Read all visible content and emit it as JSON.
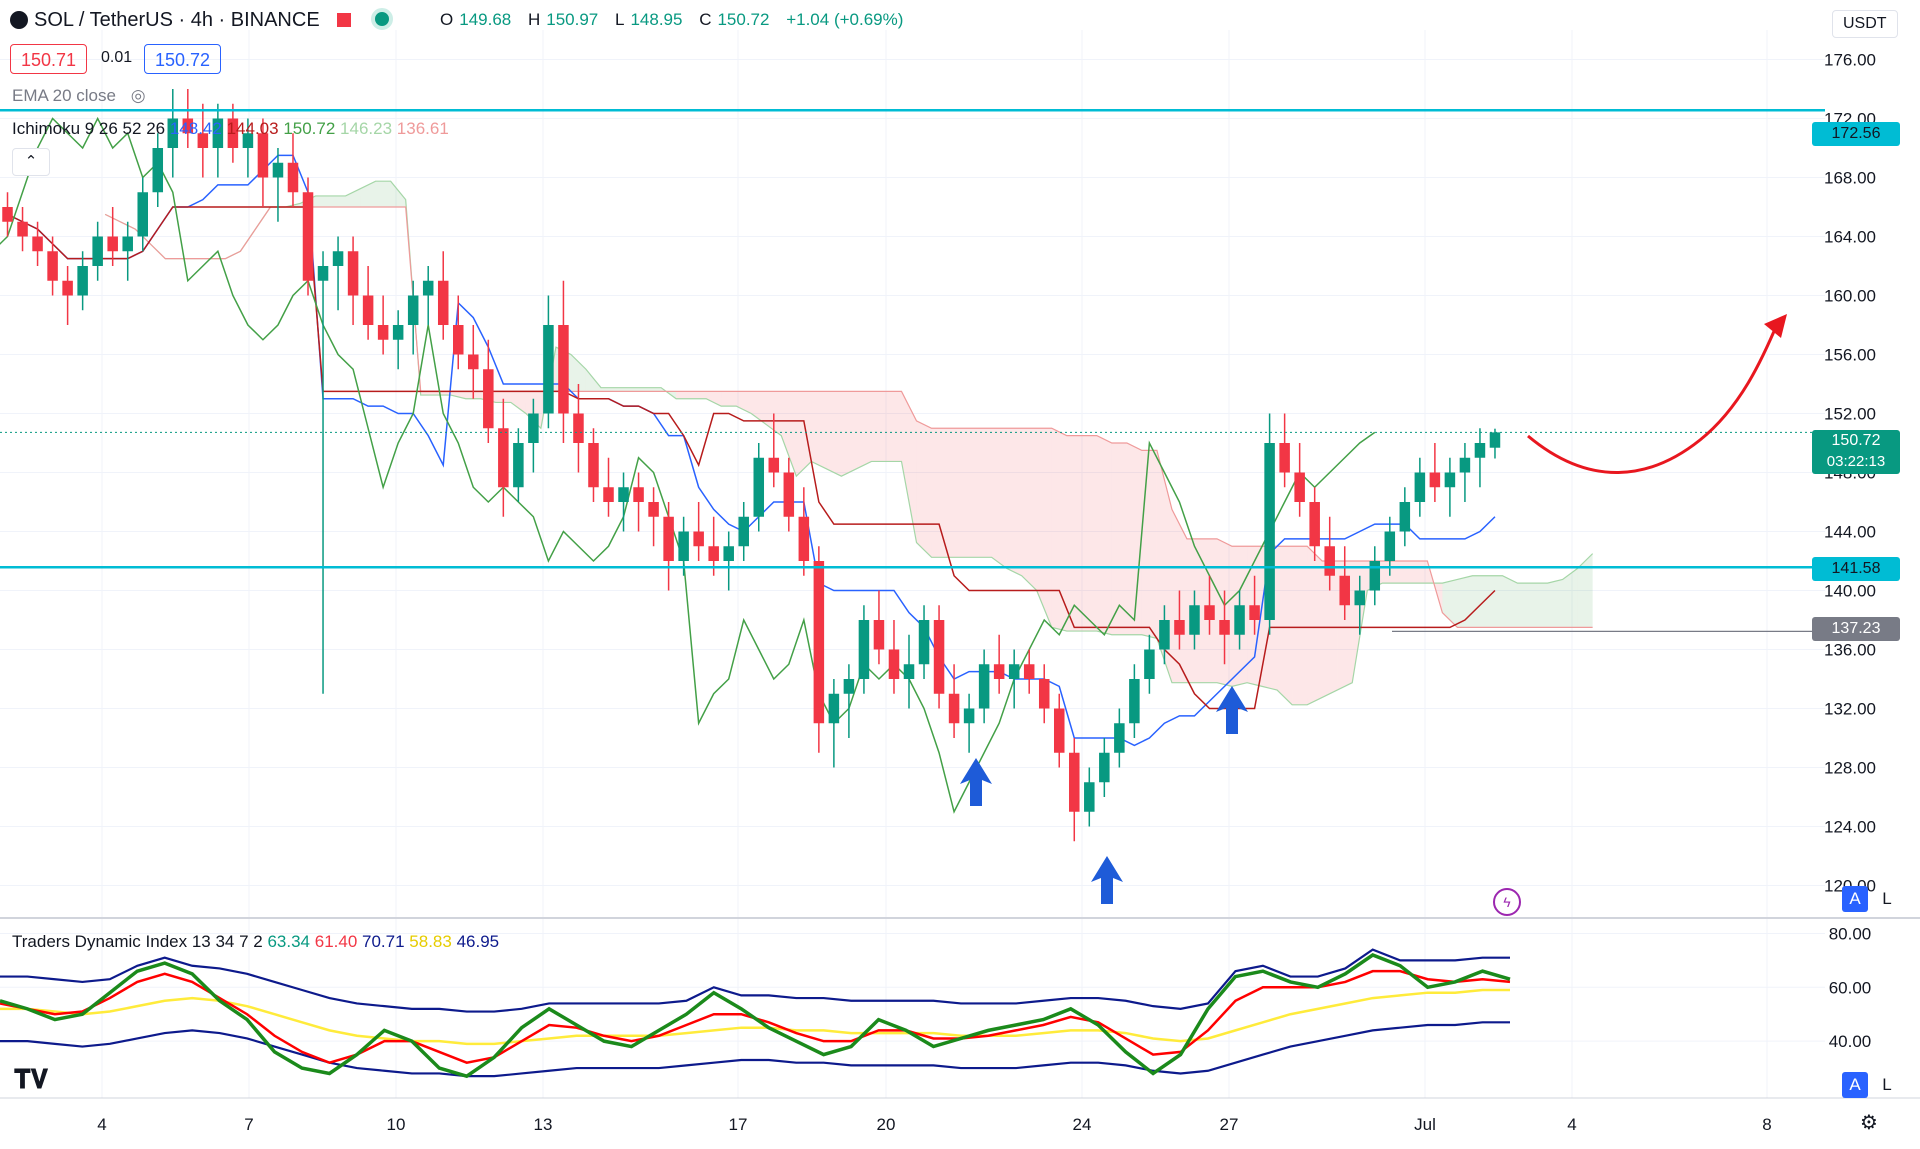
{
  "header": {
    "symbol": "SOL / TetherUS · 4h · BINANCE",
    "open_label": "O",
    "open": "149.68",
    "high_label": "H",
    "high": "150.97",
    "low_label": "L",
    "low": "148.95",
    "close_label": "C",
    "close": "150.72",
    "change": "+1.04 (+0.69%)",
    "sell_price": "150.71",
    "spread": "0.01",
    "buy_price": "150.72",
    "currency": "USDT"
  },
  "indicators": {
    "ema": "EMA 20 close",
    "ichimoku_name": "Ichimoku 9 26 52 26",
    "ichimoku_v1": "148.42",
    "ichimoku_v2": "144.03",
    "ichimoku_v3": "150.72",
    "ichimoku_v4": "146.23",
    "ichimoku_v5": "136.61",
    "tdi_name": "Traders Dynamic Index 13 34 7 2",
    "tdi_v1": "63.34",
    "tdi_v2": "61.40",
    "tdi_v3": "70.71",
    "tdi_v4": "58.83",
    "tdi_v5": "46.95"
  },
  "price_labels": {
    "current": "150.72",
    "countdown": "03:22:13",
    "resistance": "172.56",
    "support": "141.58",
    "marker": "137.23"
  },
  "scale_buttons": {
    "auto": "A",
    "log": "L"
  },
  "colors": {
    "up": "#089981",
    "down": "#f23645",
    "level_line": "#00bcd4",
    "tenkan": "#2962ff",
    "kijun": "#b71c1c",
    "chikou": "#43a047",
    "tdi_green": "#1b8a1b",
    "tdi_red": "#ff0000",
    "tdi_yellow": "#ffeb3b",
    "tdi_band": "#0d1a8c"
  },
  "chart_data": {
    "type": "candlestick",
    "title": "SOL / TetherUS · 4h · BINANCE",
    "ylim": [
      118,
      178
    ],
    "yticks": [
      "176.00",
      "172.00",
      "168.00",
      "164.00",
      "160.00",
      "156.00",
      "152.00",
      "148.00",
      "144.00",
      "140.00",
      "136.00",
      "132.00",
      "128.00",
      "124.00",
      "120.00"
    ],
    "xticks": [
      "4",
      "7",
      "10",
      "13",
      "17",
      "20",
      "24",
      "27",
      "Jul",
      "4",
      "8"
    ],
    "horizontal_levels": [
      172.56,
      141.58,
      137.23
    ],
    "candles": [
      [
        166,
        167,
        164,
        165
      ],
      [
        165,
        166,
        163,
        164
      ],
      [
        164,
        165,
        162,
        163
      ],
      [
        163,
        164,
        160,
        161
      ],
      [
        161,
        162,
        158,
        160
      ],
      [
        160,
        163,
        159,
        162
      ],
      [
        162,
        165,
        161,
        164
      ],
      [
        164,
        166,
        162,
        163
      ],
      [
        163,
        165,
        161,
        164
      ],
      [
        164,
        168,
        163,
        167
      ],
      [
        167,
        171,
        166,
        170
      ],
      [
        170,
        174,
        168,
        172
      ],
      [
        172,
        174,
        170,
        171
      ],
      [
        171,
        173,
        168,
        170
      ],
      [
        170,
        173,
        168,
        172
      ],
      [
        172,
        173,
        169,
        170
      ],
      [
        170,
        172,
        168,
        171
      ],
      [
        171,
        172,
        166,
        168
      ],
      [
        168,
        170,
        165,
        169
      ],
      [
        169,
        171,
        166,
        167
      ],
      [
        167,
        168,
        160,
        161
      ],
      [
        161,
        163,
        133,
        162
      ],
      [
        162,
        164,
        159,
        163
      ],
      [
        163,
        164,
        158,
        160
      ],
      [
        160,
        162,
        157,
        158
      ],
      [
        158,
        160,
        156,
        157
      ],
      [
        157,
        159,
        155,
        158
      ],
      [
        158,
        161,
        156,
        160
      ],
      [
        160,
        162,
        158,
        161
      ],
      [
        161,
        163,
        157,
        158
      ],
      [
        158,
        160,
        155,
        156
      ],
      [
        156,
        158,
        153,
        155
      ],
      [
        155,
        157,
        150,
        151
      ],
      [
        151,
        153,
        145,
        147
      ],
      [
        147,
        151,
        146,
        150
      ],
      [
        150,
        153,
        148,
        152
      ],
      [
        152,
        160,
        151,
        158
      ],
      [
        158,
        161,
        150,
        152
      ],
      [
        152,
        154,
        148,
        150
      ],
      [
        150,
        151,
        146,
        147
      ],
      [
        147,
        149,
        145,
        146
      ],
      [
        146,
        148,
        144,
        147
      ],
      [
        147,
        148,
        144,
        146
      ],
      [
        146,
        147,
        143,
        145
      ],
      [
        145,
        146,
        140,
        142
      ],
      [
        142,
        145,
        141,
        144
      ],
      [
        144,
        146,
        142,
        143
      ],
      [
        143,
        145,
        141,
        142
      ],
      [
        142,
        144,
        140,
        143
      ],
      [
        143,
        146,
        142,
        145
      ],
      [
        145,
        150,
        144,
        149
      ],
      [
        149,
        152,
        147,
        148
      ],
      [
        148,
        149,
        144,
        145
      ],
      [
        145,
        147,
        141,
        142
      ],
      [
        142,
        143,
        129,
        131
      ],
      [
        131,
        134,
        128,
        133
      ],
      [
        133,
        135,
        130,
        134
      ],
      [
        134,
        139,
        133,
        138
      ],
      [
        138,
        140,
        135,
        136
      ],
      [
        136,
        138,
        133,
        134
      ],
      [
        134,
        137,
        132,
        135
      ],
      [
        135,
        139,
        134,
        138
      ],
      [
        138,
        139,
        132,
        133
      ],
      [
        133,
        135,
        130,
        131
      ],
      [
        131,
        133,
        129,
        132
      ],
      [
        132,
        136,
        131,
        135
      ],
      [
        135,
        137,
        133,
        134
      ],
      [
        134,
        136,
        132,
        135
      ],
      [
        135,
        136,
        133,
        134
      ],
      [
        134,
        135,
        131,
        132
      ],
      [
        132,
        133,
        128,
        129
      ],
      [
        129,
        130,
        123,
        125
      ],
      [
        125,
        128,
        124,
        127
      ],
      [
        127,
        130,
        126,
        129
      ],
      [
        129,
        132,
        128,
        131
      ],
      [
        131,
        135,
        130,
        134
      ],
      [
        134,
        137,
        133,
        136
      ],
      [
        136,
        139,
        135,
        138
      ],
      [
        138,
        140,
        136,
        137
      ],
      [
        137,
        140,
        136,
        139
      ],
      [
        139,
        141,
        137,
        138
      ],
      [
        138,
        140,
        135,
        137
      ],
      [
        137,
        140,
        136,
        139
      ],
      [
        139,
        141,
        137,
        138
      ],
      [
        138,
        152,
        137,
        150
      ],
      [
        150,
        152,
        147,
        148
      ],
      [
        148,
        150,
        145,
        146
      ],
      [
        146,
        147,
        142,
        143
      ],
      [
        143,
        145,
        140,
        141
      ],
      [
        141,
        143,
        138,
        139
      ],
      [
        139,
        141,
        137,
        140
      ],
      [
        140,
        143,
        139,
        142
      ],
      [
        142,
        145,
        141,
        144
      ],
      [
        144,
        147,
        143,
        146
      ],
      [
        146,
        149,
        145,
        148
      ],
      [
        148,
        150,
        146,
        147
      ],
      [
        147,
        149,
        145,
        148
      ],
      [
        148,
        150,
        146,
        149
      ],
      [
        149,
        151,
        147,
        150
      ],
      [
        149.68,
        150.97,
        148.95,
        150.72
      ]
    ],
    "tdi": {
      "ylim": [
        20,
        85
      ],
      "yticks": [
        "80.00",
        "60.00",
        "40.00"
      ],
      "series": [
        {
          "values": [
            55,
            52,
            48,
            50,
            58,
            66,
            69,
            65,
            55,
            48,
            36,
            30,
            28,
            35,
            44,
            40,
            30,
            27,
            34,
            45,
            52,
            46,
            40,
            38,
            44,
            50,
            58,
            52,
            45,
            40,
            35,
            38,
            48,
            44,
            38,
            41,
            44,
            46,
            48,
            52,
            46,
            36,
            28,
            35,
            52,
            64,
            66,
            62,
            60,
            65,
            72,
            68,
            60,
            62,
            66,
            63
          ]
        },
        {
          "values": [
            54,
            52,
            50,
            51,
            56,
            62,
            65,
            62,
            56,
            50,
            42,
            36,
            32,
            35,
            40,
            40,
            36,
            32,
            34,
            40,
            46,
            45,
            42,
            40,
            42,
            46,
            50,
            50,
            47,
            43,
            40,
            40,
            44,
            44,
            41,
            41,
            42,
            44,
            46,
            49,
            47,
            41,
            35,
            36,
            44,
            55,
            60,
            60,
            60,
            62,
            66,
            66,
            63,
            62,
            63,
            62
          ]
        },
        {
          "values": [
            52,
            52,
            51,
            50,
            51,
            53,
            55,
            56,
            55,
            53,
            50,
            47,
            44,
            42,
            41,
            40,
            40,
            39,
            39,
            40,
            41,
            42,
            42,
            42,
            42,
            43,
            44,
            45,
            45,
            44,
            44,
            43,
            43,
            43,
            43,
            42,
            42,
            42,
            43,
            44,
            44,
            43,
            41,
            40,
            41,
            44,
            47,
            50,
            52,
            54,
            56,
            57,
            58,
            58,
            59,
            59
          ]
        }
      ]
    }
  }
}
